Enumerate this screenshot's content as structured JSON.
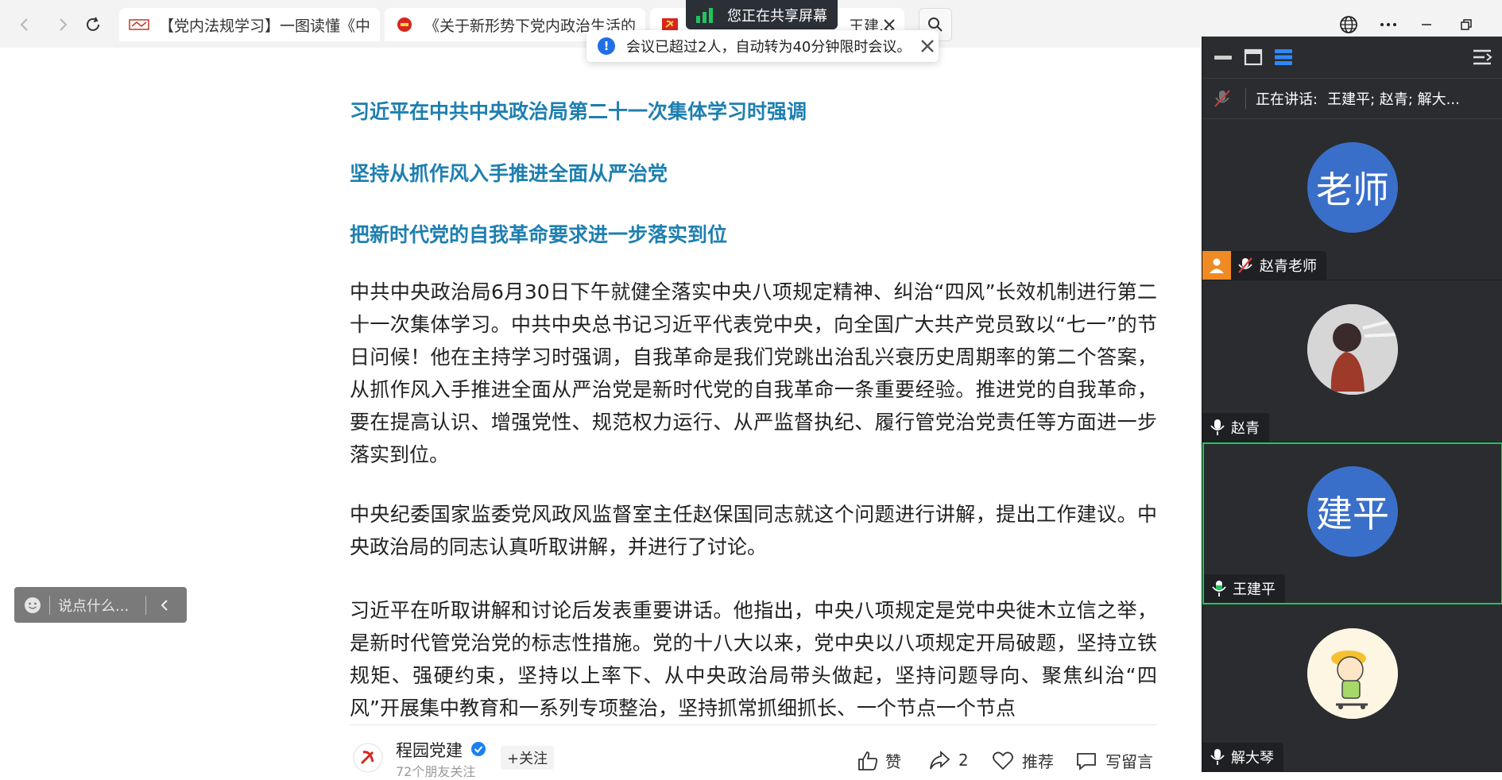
{
  "browser": {
    "tabs": [
      {
        "title": "【党内法规学习】一图读懂《中国…",
        "favicon": "party-rules-icon"
      },
      {
        "title": "《关于新形势下党内政治生活的若干…",
        "favicon": "red-seal-icon"
      },
      {
        "title": "王建…",
        "favicon": "party-emblem-icon"
      }
    ],
    "colors": {
      "bar": "#f3f3f3",
      "tab_active": "#ffffff"
    }
  },
  "sharing": {
    "label": "您正在共享屏幕",
    "icon": "signal-bars-icon"
  },
  "toast": {
    "text": "会议已超过2人，自动转为40分钟限时会议。",
    "icon": "info-icon"
  },
  "article": {
    "headings": [
      "习近平在中共中央政治局第二十一次集体学习时强调",
      "坚持从抓作风入手推进全面从严治党",
      "把新时代党的自我革命要求进一步落实到位"
    ],
    "paragraphs": [
      "中共中央政治局6月30日下午就健全落实中央八项规定精神、纠治“四风”长效机制进行第二十一次集体学习。中共中央总书记习近平代表党中央，向全国广大共产党员致以“七一”的节日问候！他在主持学习时强调，自我革命是我们党跳出治乱兴衰历史周期率的第二个答案，从抓作风入手推进全面从严治党是新时代党的自我革命一条重要经验。推进党的自我革命，要在提高认识、增强党性、规范权力运行、从严监督执纪、履行管党治党责任等方面进一步落实到位。",
      "中央纪委国家监委党风政风监督室主任赵保国同志就这个问题进行讲解，提出工作建议。中央政治局的同志认真听取讲解，并进行了讨论。",
      "习近平在听取讲解和讨论后发表重要讲话。他指出，中央八项规定是党中央徙木立信之举，是新时代管党治党的标志性措施。党的十八大以来，党中央以八项规定开局破题，坚持立铁规矩、强硬约束，坚持以上率下、从中央政治局带头做起，坚持问题导向、聚焦纠治“四风”开展集中教育和一系列专项整治，坚持抓常抓细抓长、一个节点一个节点"
    ],
    "heading_color": "#1e7fb0"
  },
  "comment": {
    "placeholder": "说点什么...",
    "icon": "emoji-icon",
    "collapse_icon": "chevron-left-icon"
  },
  "footer": {
    "account": "程园党建",
    "followers": "72个朋友关注",
    "follow": "+关注",
    "like": "赞",
    "share_count": "2",
    "recommend": "推荐",
    "comment": "写留言"
  },
  "meeting": {
    "speaking_label": "正在讲话:",
    "speaking_names": "王建平; 赵青; 解大...",
    "participants": [
      {
        "avatar_text": "老师",
        "name": "赵青老师",
        "host": true,
        "muted": true,
        "avatar_color": "#3a6fc9"
      },
      {
        "avatar_text": "",
        "name": "赵青",
        "host": false,
        "muted": false,
        "avatar_color": "#dddddd"
      },
      {
        "avatar_text": "建平",
        "name": "王建平",
        "host": false,
        "muted": false,
        "active": true,
        "avatar_color": "#3a6fc9"
      },
      {
        "avatar_text": "",
        "name": "解大琴",
        "host": false,
        "muted": false,
        "avatar_color": "#fdf6e3"
      }
    ],
    "colors": {
      "panel": "#2a2c30",
      "active_border": "#22c35e",
      "host_badge": "#f08a24"
    }
  }
}
